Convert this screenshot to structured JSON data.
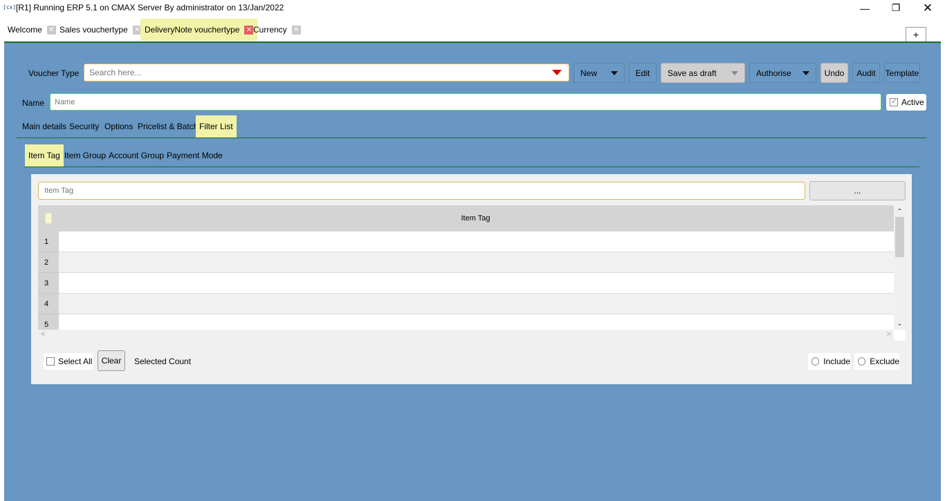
{
  "window": {
    "logo": "[cx]",
    "title": "[R1] Running ERP 5.1 on CMAX Server By administrator on 13/Jan/2022",
    "minimize": "—",
    "maximize": "❐",
    "close": "✕"
  },
  "tabs": [
    {
      "label": "Welcome",
      "close": "✕"
    },
    {
      "label": "Sales vouchertype",
      "close": "✕"
    },
    {
      "label": "DeliveryNote vouchertype",
      "close": "✕"
    },
    {
      "label": "Currency",
      "close": "✕"
    }
  ],
  "add_tab": "+",
  "toolbar": {
    "voucher_type_label": "Voucher Type",
    "search_placeholder": "Search here...",
    "new": "New",
    "edit": "Edit",
    "save_as_draft": "Save as draft",
    "authorise": "Authorise",
    "undo": "Undo",
    "audit": "Audit",
    "template": "Template"
  },
  "name_row": {
    "label": "Name",
    "placeholder": "Name",
    "active_label": "Active",
    "active_checked": true
  },
  "main_tabs": [
    "Main details",
    "Security",
    "Options",
    "Pricelist & Batch",
    "Filter List"
  ],
  "filter_tabs": [
    "Item Tag",
    "Item Group",
    "Account Group",
    "Payment Mode"
  ],
  "filter_panel": {
    "input_placeholder": "Item Tag",
    "browse_button": "...",
    "grid_header": "Item Tag",
    "rows": [
      "1",
      "2",
      "3",
      "4",
      "5"
    ],
    "scroll_up": "⌃",
    "scroll_down": "⌄",
    "scroll_left": "<",
    "scroll_right": ">",
    "select_all": "Select All",
    "clear": "Clear",
    "selected_count": "Selected Count",
    "include": "Include",
    "exclude": "Exclude"
  },
  "colors": {
    "main_bg": "#6797c2",
    "active_tab": "#f0f3a8",
    "accent_line": "#1b6b2a",
    "dropdown_arrow": "#e60000"
  }
}
